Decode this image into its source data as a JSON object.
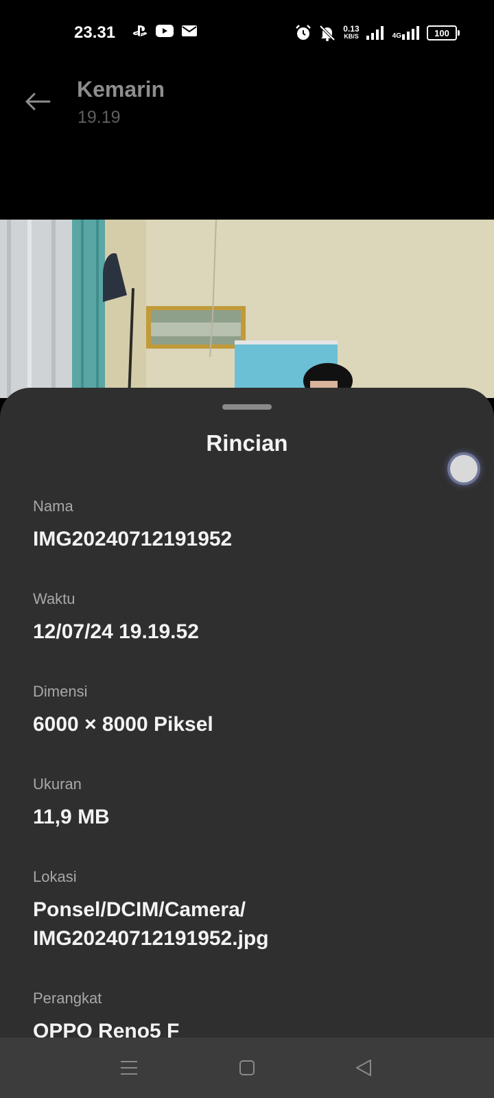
{
  "status_bar": {
    "time": "23.31",
    "net_speed_value": "0.13",
    "net_speed_unit": "KB/S",
    "network_type": "4G",
    "battery": "100",
    "icons": [
      "playstation-icon",
      "youtube-icon",
      "mail-icon",
      "alarm-icon",
      "mute-icon",
      "signal-icon",
      "signal-4g-icon",
      "battery-icon"
    ]
  },
  "header": {
    "title": "Kemarin",
    "subtitle": "19.19"
  },
  "sheet": {
    "title": "Rincian",
    "fields": [
      {
        "label": "Nama",
        "value": "IMG20240712191952"
      },
      {
        "label": "Waktu",
        "value": "12/07/24 19.19.52"
      },
      {
        "label": "Dimensi",
        "value": "6000 × 8000 Piksel"
      },
      {
        "label": "Ukuran",
        "value": "11,9 MB"
      },
      {
        "label": "Lokasi",
        "value_line1": "Ponsel/DCIM/Camera/",
        "value_line2": "IMG20240712191952.jpg"
      },
      {
        "label": "Perangkat",
        "value": "OPPO Reno5 F"
      }
    ]
  },
  "navbar": {
    "icons": [
      "menu-icon",
      "home-icon",
      "back-triangle-icon"
    ]
  }
}
